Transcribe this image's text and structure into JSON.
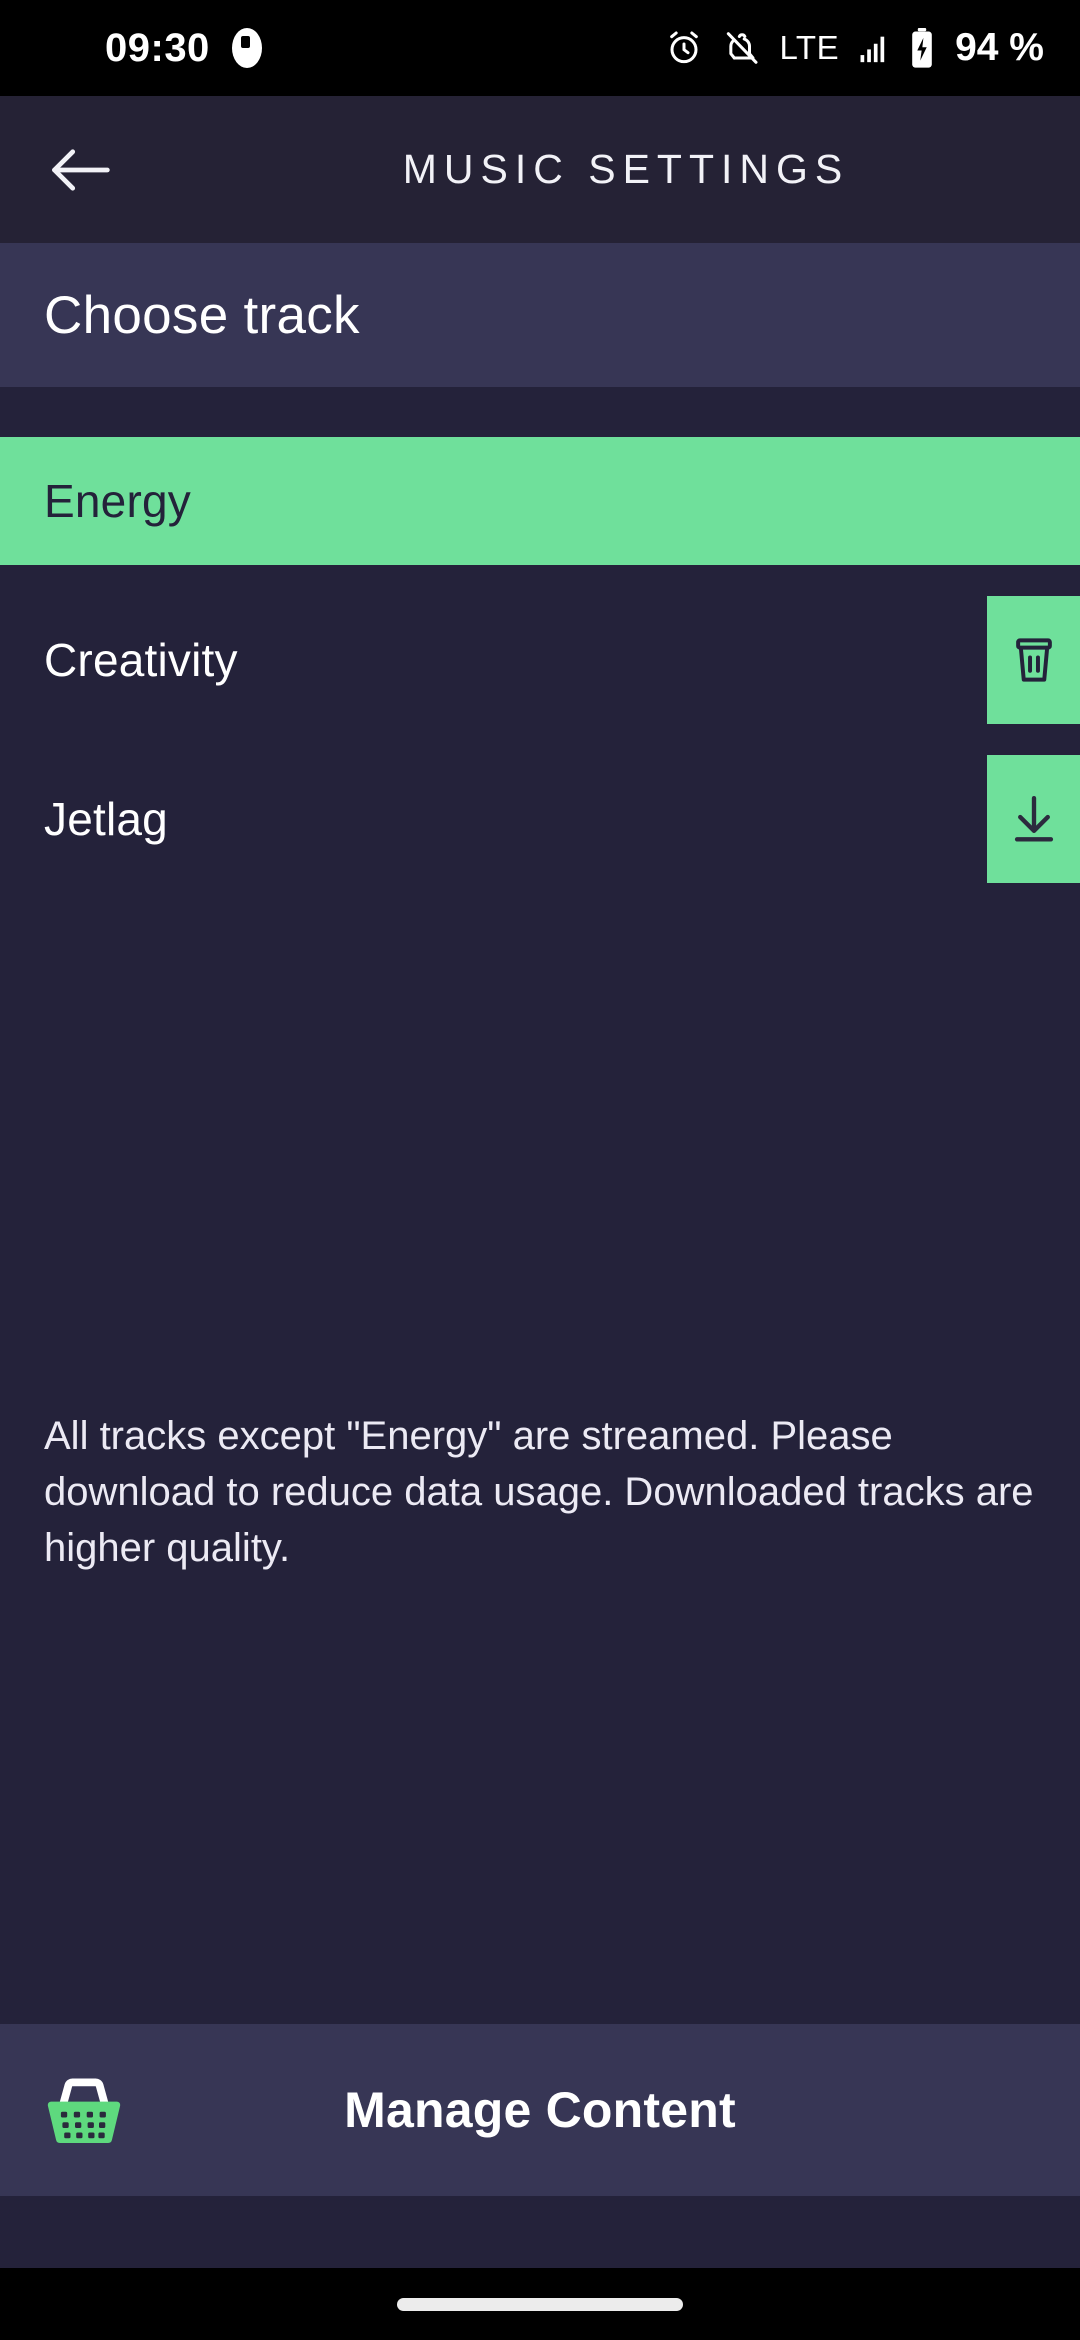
{
  "status_bar": {
    "time": "09:30",
    "left_icon": "notification-dot-icon",
    "icons": [
      "alarm-icon",
      "bell-muted-icon"
    ],
    "network": "LTE",
    "signal_icon": "signal-bars-icon",
    "battery_icon": "battery-charging-icon",
    "battery_level": "94 %"
  },
  "app_bar": {
    "back_icon": "arrow-left-icon",
    "title": "MUSIC SETTINGS"
  },
  "section": {
    "title": "Choose track"
  },
  "tracks": [
    {
      "name": "Energy",
      "selected": true,
      "action": "none"
    },
    {
      "name": "Creativity",
      "selected": false,
      "action": "delete-icon"
    },
    {
      "name": "Jetlag",
      "selected": false,
      "action": "download-icon"
    }
  ],
  "note": "All tracks except \"Energy\" are streamed. Please download to reduce data usage. Downloaded tracks are higher quality.",
  "bottom_bar": {
    "icon": "basket-icon",
    "label": "Manage Content"
  },
  "colors": {
    "background": "#24223a",
    "app_bar": "#252235",
    "section_band": "#373655",
    "accent_green": "#6fe09b",
    "text_primary": "#ffffff",
    "text_on_accent": "#24223a",
    "status_bar": "#000000"
  }
}
